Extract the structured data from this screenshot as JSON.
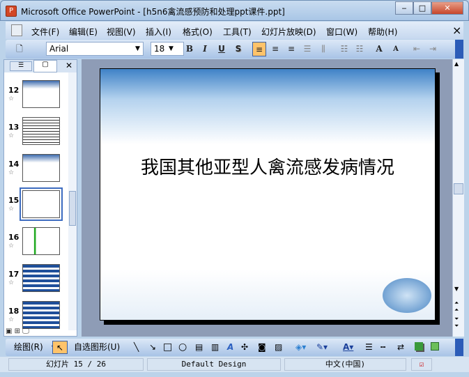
{
  "window": {
    "title": "Microsoft Office PowerPoint - [h5n6禽流感预防和处理ppt课件.ppt]",
    "minimize": "‒",
    "maximize": "□",
    "close": "✕"
  },
  "menu": {
    "items": [
      "文件(F)",
      "编辑(E)",
      "视图(V)",
      "插入(I)",
      "格式(O)",
      "工具(T)",
      "幻灯片放映(D)",
      "窗口(W)",
      "帮助(H)"
    ],
    "close": "×"
  },
  "toolbar": {
    "font": "Arial",
    "size": "18",
    "bold": "B",
    "italic": "I",
    "underline": "U",
    "shadow": "S",
    "grow": "A",
    "shrink": "A"
  },
  "thumbnails": [
    {
      "num": "12"
    },
    {
      "num": "13"
    },
    {
      "num": "14"
    },
    {
      "num": "15",
      "selected": true
    },
    {
      "num": "16"
    },
    {
      "num": "17"
    },
    {
      "num": "18"
    }
  ],
  "slide": {
    "title": "我国其他亚型人禽流感发病情况"
  },
  "drawbar": {
    "draw": "绘图(R)",
    "autoshapes": "自选图形(U)"
  },
  "status": {
    "slide": "幻灯片 15 / 26",
    "design": "Default Design",
    "language": "中文(中国)"
  },
  "colors": {
    "accent": "#ffc36a",
    "workspace": "#8e9cb6"
  }
}
